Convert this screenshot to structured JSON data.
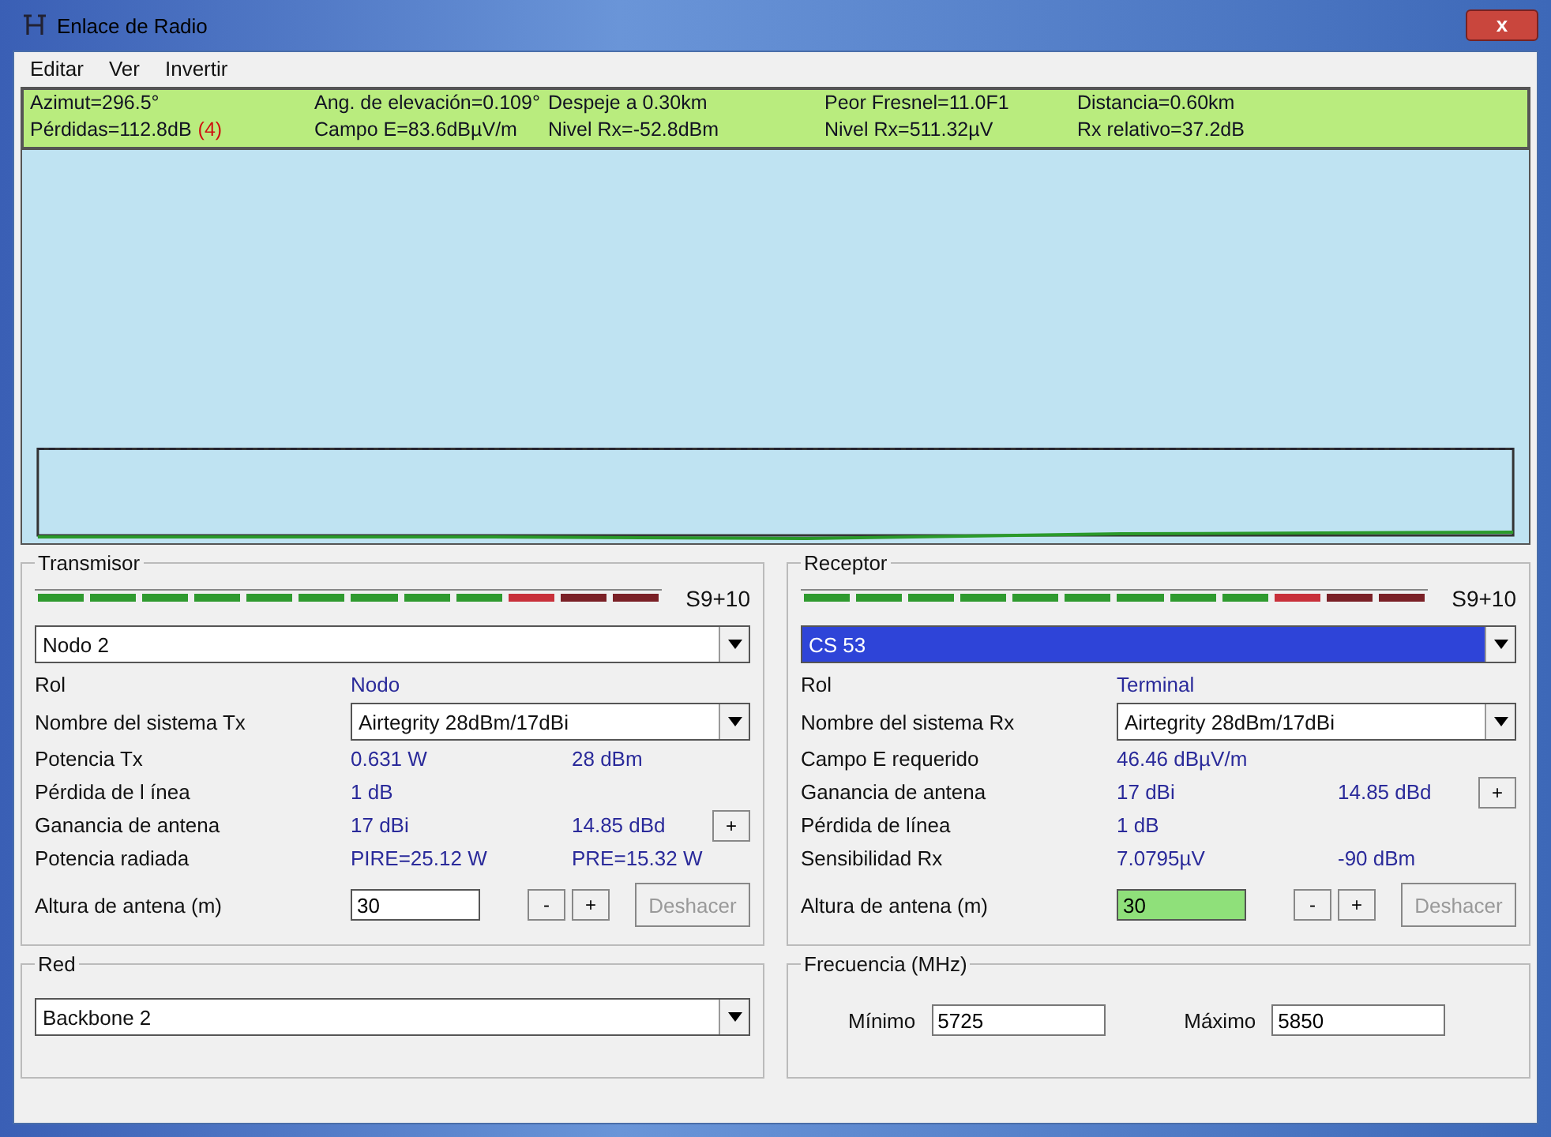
{
  "window": {
    "title": "Enlace de Radio",
    "close": "x"
  },
  "menu": [
    "Editar",
    "Ver",
    "Invertir"
  ],
  "info": [
    {
      "text": "Azimut=296.5°"
    },
    {
      "text": "Ang. de elevación=0.109°"
    },
    {
      "text": "Despeje a 0.30km"
    },
    {
      "text": "Peor Fresnel=11.0F1"
    },
    {
      "text": "Distancia=0.60km"
    },
    {
      "text": "Pérdidas=112.8dB",
      "flag": "(4)"
    },
    {
      "text": "Campo E=83.6dBµV/m"
    },
    {
      "text": "Nivel Rx=-52.8dBm"
    },
    {
      "text": "Nivel Rx=511.32µV"
    },
    {
      "text": "Rx relativo=37.2dB"
    }
  ],
  "stations": [
    {
      "title": "Transmisor",
      "meter": {
        "level": 1,
        "reading": "S9+10"
      },
      "unit": "Nodo 2",
      "unit_focused": false,
      "rows": [
        {
          "kind": "text",
          "label": "Rol",
          "value": "Nodo"
        },
        {
          "kind": "select",
          "label": "Nombre del sistema Tx",
          "value": "Airtegrity 28dBm/17dBi"
        },
        {
          "kind": "text",
          "label": "Potencia Tx",
          "value": "0.631 W",
          "value2": "28 dBm"
        },
        {
          "kind": "text",
          "label": "Pérdida de l ínea",
          "value": "1 dB"
        },
        {
          "kind": "plus",
          "label": "Ganancia de antena",
          "value": "17 dBi",
          "value2": "14.85 dBd",
          "button": "+"
        },
        {
          "kind": "text",
          "label": "Potencia radiada",
          "value": "PIRE=25.12 W",
          "value2": "PRE=15.32 W"
        }
      ],
      "height": {
        "label": "Altura de antena (m)",
        "value": "30",
        "highlighted": false,
        "minus": "-",
        "plus": "+",
        "undo": "Deshacer",
        "undo_disabled": true
      }
    },
    {
      "title": "Receptor",
      "meter": {
        "level": 1,
        "reading": "S9+10"
      },
      "unit": "CS 53",
      "unit_focused": true,
      "rows": [
        {
          "kind": "text",
          "label": "Rol",
          "value": "Terminal"
        },
        {
          "kind": "select",
          "label": "Nombre del sistema Rx",
          "value": "Airtegrity 28dBm/17dBi"
        },
        {
          "kind": "text",
          "label": "Campo E requerido",
          "value": "46.46 dBµV/m"
        },
        {
          "kind": "plus",
          "label": "Ganancia de antena",
          "value": "17 dBi",
          "value2": "14.85 dBd",
          "button": "+"
        },
        {
          "kind": "text",
          "label": "Pérdida de línea",
          "value": "1 dB"
        },
        {
          "kind": "text",
          "label": "Sensibilidad Rx",
          "value": "7.0795µV",
          "value2": "-90 dBm"
        }
      ],
      "height": {
        "label": "Altura de antena (m)",
        "value": "30",
        "highlighted": true,
        "minus": "-",
        "plus": "+",
        "undo": "Deshacer",
        "undo_disabled": true
      }
    }
  ],
  "network": {
    "title": "Red",
    "value": "Backbone 2"
  },
  "frequency": {
    "title": "Frecuencia (MHz)",
    "min_label": "Mínimo",
    "min": "5725",
    "max_label": "Máximo",
    "max": "5850"
  }
}
